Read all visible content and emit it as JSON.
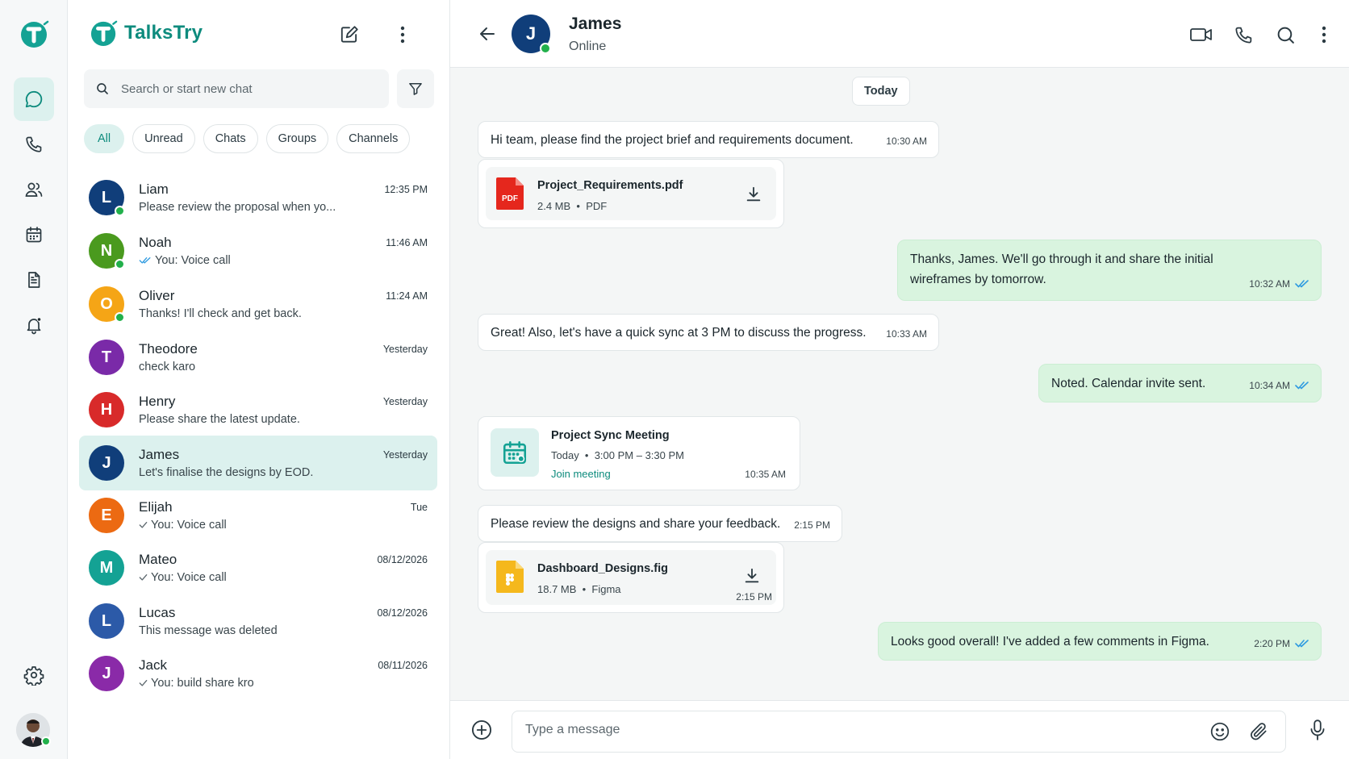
{
  "brand": {
    "name": "TalksTry",
    "color": "#0d8b7d"
  },
  "rail": {
    "items": [
      {
        "icon": "chat-icon",
        "active": true
      },
      {
        "icon": "phone-icon"
      },
      {
        "icon": "contacts-icon"
      },
      {
        "icon": "calendar-icon"
      },
      {
        "icon": "document-icon"
      },
      {
        "icon": "bell-icon"
      }
    ],
    "settings_icon": "gear-icon"
  },
  "search": {
    "placeholder": "Search or start new chat"
  },
  "filters": [
    "All",
    "Unread",
    "Chats",
    "Groups",
    "Channels"
  ],
  "chats": [
    {
      "name": "Liam",
      "initial": "L",
      "color": "#103e7a",
      "online": true,
      "time": "12:35 PM",
      "preview": "Please review the proposal when yo...",
      "tick": ""
    },
    {
      "name": "Noah",
      "initial": "N",
      "color": "#4a9a1e",
      "online": true,
      "time": "11:46 AM",
      "preview": "You: Voice call",
      "tick": "double-blue"
    },
    {
      "name": "Oliver",
      "initial": "O",
      "color": "#f5a516",
      "online": true,
      "time": "11:24 AM",
      "preview": "Thanks! I'll check and get back.",
      "tick": ""
    },
    {
      "name": "Theodore",
      "initial": "T",
      "color": "#7a2aa8",
      "online": false,
      "time": "Yesterday",
      "preview": "check karo",
      "tick": ""
    },
    {
      "name": "Henry",
      "initial": "H",
      "color": "#d82a2a",
      "online": false,
      "time": "Yesterday",
      "preview": "Please share the latest update.",
      "tick": ""
    },
    {
      "name": "James",
      "initial": "J",
      "color": "#103e7a",
      "online": false,
      "time": "Yesterday",
      "preview": "Let's finalise the designs by EOD.",
      "tick": "",
      "selected": true
    },
    {
      "name": "Elijah",
      "initial": "E",
      "color": "#ec6a12",
      "online": false,
      "time": "Tue",
      "preview": "You: Voice call",
      "tick": "single"
    },
    {
      "name": "Mateo",
      "initial": "M",
      "color": "#14a294",
      "online": false,
      "time": "08/12/2026",
      "preview": "You: Voice call",
      "tick": "single"
    },
    {
      "name": "Lucas",
      "initial": "L",
      "color": "#2c5aa8",
      "online": false,
      "time": "08/12/2026",
      "preview": "This message was deleted",
      "tick": ""
    },
    {
      "name": "Jack",
      "initial": "J",
      "color": "#8a2aa8",
      "online": false,
      "time": "08/11/2026",
      "preview": "You: build share kro",
      "tick": "single"
    }
  ],
  "conversation": {
    "name": "James",
    "initial": "J",
    "status": "Online",
    "day_label": "Today",
    "messages": {
      "m1": {
        "text": "Hi team, please find the project brief and requirements document.",
        "time": "10:30 AM"
      },
      "f1": {
        "name": "Project_Requirements.pdf",
        "size": "2.4 MB",
        "type": "PDF",
        "badge": "PDF"
      },
      "m2": {
        "line1": "Thanks, James. We'll go through it and share the initial",
        "line2": "wireframes by tomorrow.",
        "time": "10:32 AM"
      },
      "m3": {
        "text": "Great! Also, let's have a quick sync at 3 PM to discuss the progress.",
        "time": "10:33 AM"
      },
      "m4": {
        "text": "Noted. Calendar invite sent.",
        "time": "10:34 AM"
      },
      "meet": {
        "title": "Project Sync Meeting",
        "day": "Today",
        "range": "3:00 PM – 3:30 PM",
        "link": "Join meeting",
        "time": "10:35 AM"
      },
      "m5": {
        "text": "Please review the designs and share your feedback.",
        "time": "2:15 PM"
      },
      "f2": {
        "name": "Dashboard_Designs.fig",
        "size": "18.7 MB",
        "type": "Figma",
        "time": "2:15 PM"
      },
      "m6": {
        "text": "Looks good overall! I've added a few comments in Figma.",
        "time": "2:20 PM"
      }
    }
  },
  "composer": {
    "placeholder": "Type a message"
  }
}
